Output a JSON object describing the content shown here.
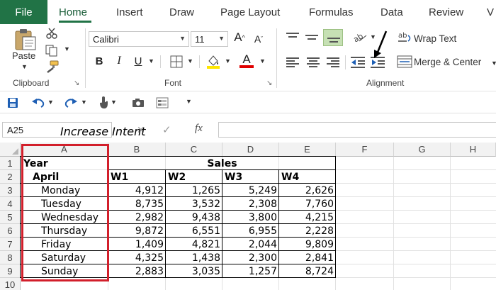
{
  "ribbon_tabs": {
    "file": "File",
    "home": "Home",
    "insert": "Insert",
    "draw": "Draw",
    "page_layout": "Page Layout",
    "formulas": "Formulas",
    "data": "Data",
    "review": "Review",
    "view_partial": "V"
  },
  "clipboard": {
    "paste_label": "Paste",
    "group_label": "Clipboard"
  },
  "font": {
    "font_name": "Calibri",
    "font_size": "11",
    "group_label": "Font",
    "bold": "B",
    "italic": "I",
    "underline": "U",
    "grow": "A",
    "shrink": "A",
    "font_color_letter": "A"
  },
  "alignment": {
    "wrap_text": "Wrap Text",
    "merge_center": "Merge & Center",
    "group_label": "Alignment"
  },
  "formula_bar": {
    "name_box": "A25",
    "fx": "fx",
    "value": ""
  },
  "caption": "Increase Intent",
  "columns": [
    "A",
    "B",
    "C",
    "D",
    "E",
    "F",
    "G",
    "H"
  ],
  "rows": [
    "1",
    "2",
    "3",
    "4",
    "5",
    "6",
    "7",
    "8",
    "9",
    "10"
  ],
  "sheet": {
    "a1": "Year",
    "sales_header": "Sales",
    "a2": "April",
    "week_headers": [
      "W1",
      "W2",
      "W3",
      "W4"
    ],
    "days": [
      "Monday",
      "Tuesday",
      "Wednesday",
      "Thursday",
      "Friday",
      "Saturday",
      "Sunday"
    ],
    "values": [
      [
        "4,912",
        "1,265",
        "5,249",
        "2,626"
      ],
      [
        "8,735",
        "3,532",
        "2,308",
        "7,760"
      ],
      [
        "2,982",
        "9,438",
        "3,800",
        "4,215"
      ],
      [
        "9,872",
        "6,551",
        "6,955",
        "2,228"
      ],
      [
        "1,409",
        "4,821",
        "2,044",
        "9,809"
      ],
      [
        "4,325",
        "1,438",
        "2,300",
        "2,841"
      ],
      [
        "2,883",
        "3,035",
        "1,257",
        "8,724"
      ]
    ]
  },
  "colors": {
    "excel_green": "#217346",
    "highlight_red": "#d21f2b",
    "font_color_bar": "#e00000",
    "fill_color_bar": "#ffe600"
  },
  "icons": [
    "paste-icon",
    "cut-icon",
    "copy-icon",
    "format-painter-icon",
    "borders-icon",
    "fill-color-icon",
    "font-color-icon",
    "orientation-icon",
    "decrease-indent-icon",
    "increase-indent-icon",
    "wrap-text-icon",
    "merge-center-icon",
    "save-icon",
    "undo-icon",
    "redo-icon",
    "touch-mode-icon",
    "camera-icon",
    "form-icon",
    "arrow-annotation-icon"
  ]
}
